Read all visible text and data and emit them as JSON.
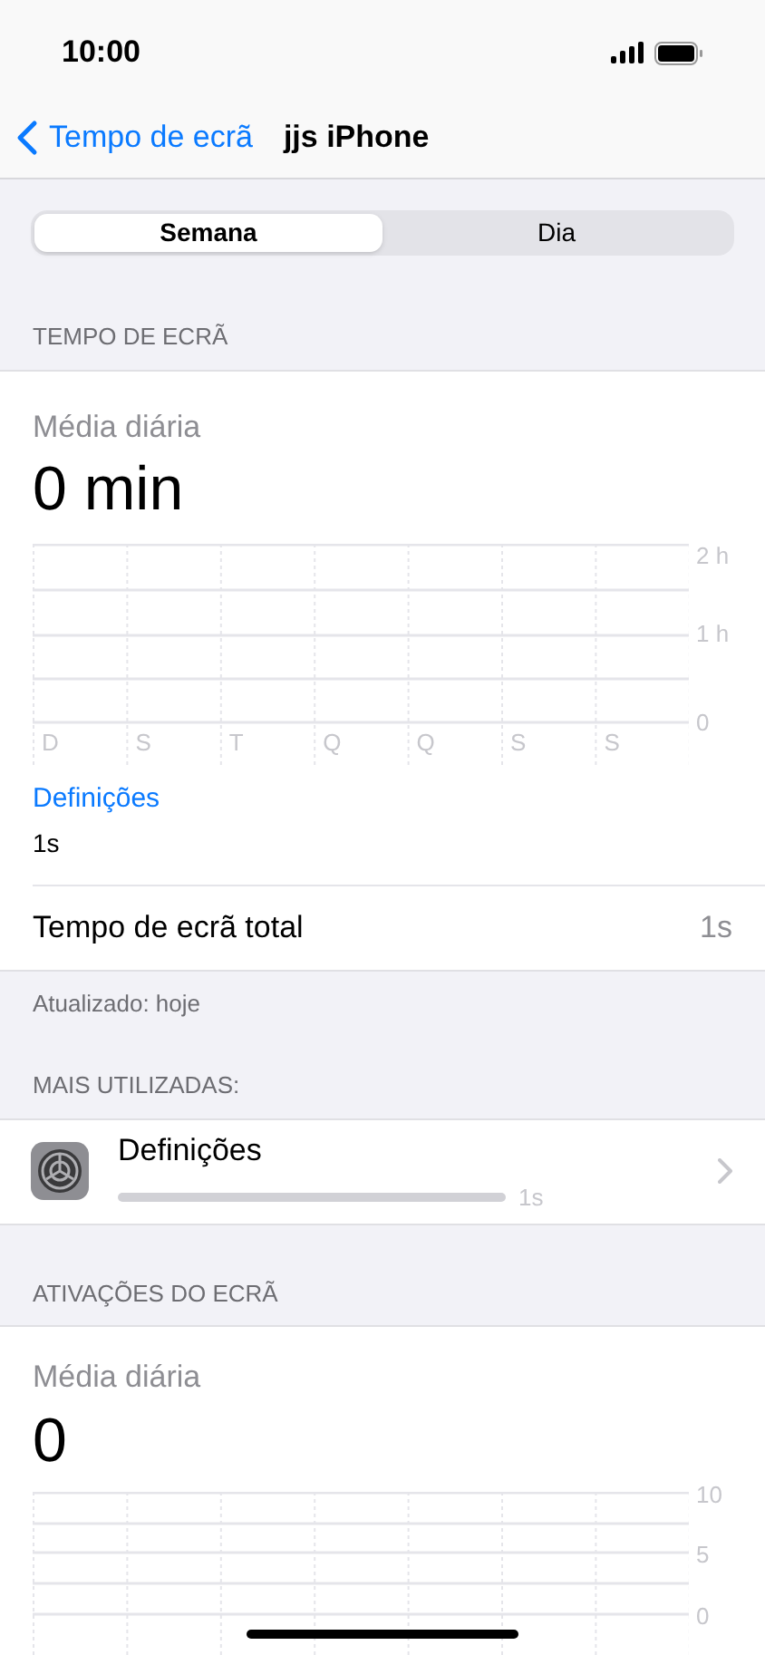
{
  "status_bar": {
    "time": "10:00"
  },
  "nav": {
    "back": "Tempo de ecrã",
    "title": "jjs iPhone"
  },
  "segments": [
    {
      "label": "Semana",
      "selected": true
    },
    {
      "label": "Dia",
      "selected": false
    }
  ],
  "screen_time": {
    "header": "TEMPO DE ECRÃ",
    "avg_label": "Média diária",
    "avg_value": "0 min",
    "chart": {
      "y_labels": [
        "2 h",
        "1 h",
        "0"
      ],
      "day_labels": [
        "D",
        "S",
        "T",
        "Q",
        "Q",
        "S",
        "S"
      ]
    },
    "top_app": "Definições",
    "top_app_time": "1s",
    "total_label": "Tempo de ecrã total",
    "total_value": "1s",
    "footer": "Atualizado: hoje"
  },
  "most_used": {
    "header": "MAIS UTILIZADAS:",
    "items": [
      {
        "name": "Definições",
        "time": "1s"
      }
    ]
  },
  "pickups": {
    "header": "ATIVAÇÕES DO ECRÃ",
    "avg_label": "Média diária",
    "avg_value": "0",
    "chart": {
      "y_labels": [
        "10",
        "5",
        "0"
      ]
    }
  }
}
